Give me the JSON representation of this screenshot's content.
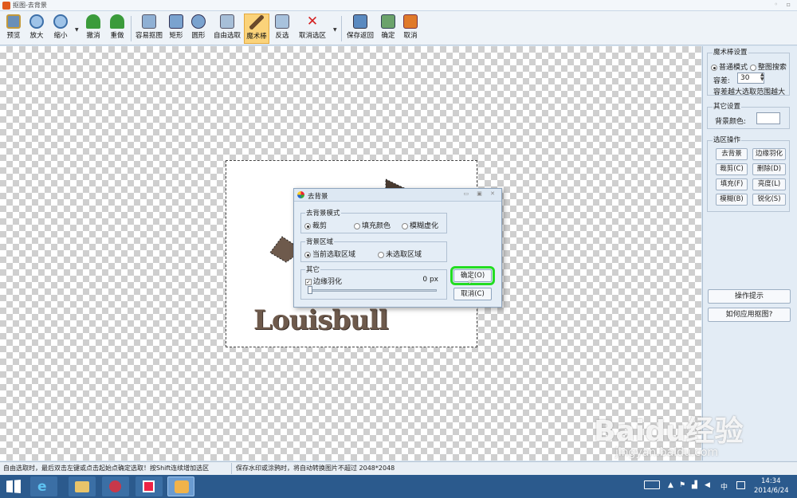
{
  "window": {
    "title": "抠图-去背景"
  },
  "toolbar": {
    "preview": "预览",
    "zoom_in": "放大",
    "zoom_out": "缩小",
    "undo": "撤消",
    "redo": "重做",
    "easy_cutout": "容易抠图",
    "rect": "矩形",
    "ellipse": "圆形",
    "free_select": "自由选取",
    "magic_wand": "魔术棒",
    "invert": "反选",
    "cancel_selection": "取消选区",
    "save_return": "保存返回",
    "ok": "确定",
    "cancel": "取消"
  },
  "canvas": {
    "logo_text": "Louisbull"
  },
  "panel": {
    "wand_settings": {
      "title": "魔术棒设置",
      "mode_normal": "普通模式",
      "mode_whole": "整图搜索",
      "tolerance_label": "容差:",
      "tolerance_value": "30",
      "hint": "容差越大选取范围越大"
    },
    "other_settings": {
      "title": "其它设置",
      "bg_color_label": "背景颜色:",
      "bg_color": "#ffffff"
    },
    "selection_ops": {
      "title": "选区操作",
      "remove_bg": "去背景",
      "edge_feather": "边缘羽化",
      "crop": "裁剪(C)",
      "delete": "删除(D)",
      "fill": "填充(F)",
      "brightness": "亮度(L)",
      "blur": "模糊(B)",
      "sharpen": "锐化(S)"
    },
    "tips_button": "操作提示",
    "howto_button": "如何应用抠图?"
  },
  "dialog": {
    "title": "去背景",
    "mode_group": "去背景模式",
    "mode_crop": "裁剪",
    "mode_fill": "填充颜色",
    "mode_blur": "模糊虚化",
    "area_group": "背景区域",
    "area_current": "当前选取区域",
    "area_unselected": "未选取区域",
    "other_group": "其它",
    "feather_label": "边缘羽化",
    "feather_value": "0 px",
    "ok_button": "确定(O)",
    "cancel_button": "取消(C)",
    "highlight_color": "#22dd22"
  },
  "statusbar": {
    "left": "自由选取时，最后双击左键或点击起始点确定选取！按Shift连续增加选区",
    "right": "保存水印或涂鸦时，将自动转换图片不超过 2048*2048"
  },
  "taskbar": {
    "time": "14:34",
    "date": "2014/6/24",
    "ime": "中"
  },
  "watermark": {
    "brand": "Baidu经验",
    "url": "jingyan.baidu.com"
  }
}
